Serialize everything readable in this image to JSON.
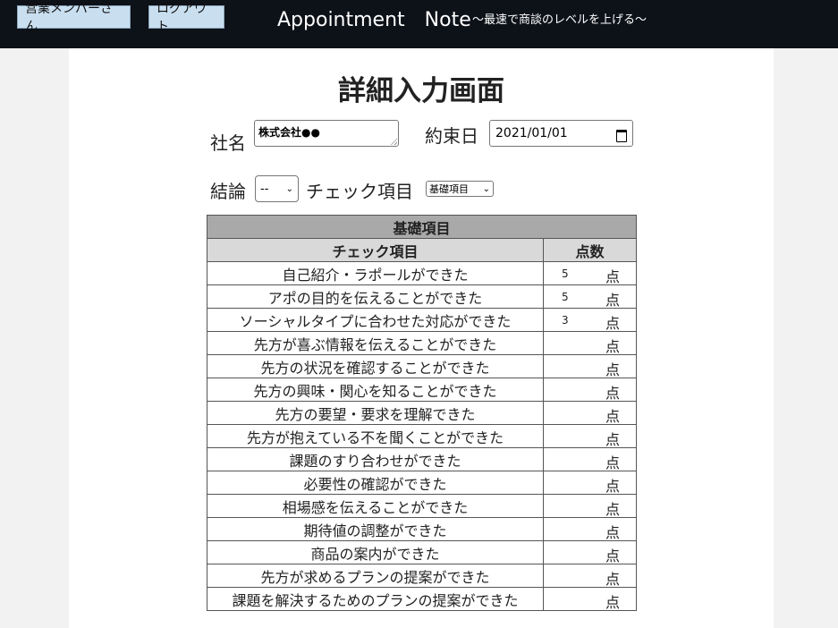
{
  "header": {
    "member_button": "営業メンバーさん",
    "logout_button": "ログアウト",
    "app_title": "Appointment　Note",
    "app_subtitle": "〜最速で商談のレベルを上げる〜"
  },
  "form": {
    "page_title": "詳細入力画面",
    "company_label": "社名",
    "company_value": "株式会社●●",
    "date_label": "約束日",
    "date_value": "2021/01/01",
    "conclusion_label": "結論",
    "conclusion_selected": "--",
    "check_label": "チェック項目",
    "check_selected": "基礎項目"
  },
  "table": {
    "section_title": "基礎項目",
    "col_item": "チェック項目",
    "col_score": "点数",
    "unit": "点",
    "rows": [
      {
        "item": "自己紹介・ラポールができた",
        "score": "5"
      },
      {
        "item": "アポの目的を伝えることができた",
        "score": "5"
      },
      {
        "item": "ソーシャルタイプに合わせた対応ができた",
        "score": "3"
      },
      {
        "item": "先方が喜ぶ情報を伝えることができた",
        "score": ""
      },
      {
        "item": "先方の状況を確認することができた",
        "score": ""
      },
      {
        "item": "先方の興味・関心を知ることができた",
        "score": ""
      },
      {
        "item": "先方の要望・要求を理解できた",
        "score": ""
      },
      {
        "item": "先方が抱えている不を聞くことができた",
        "score": ""
      },
      {
        "item": "課題のすり合わせができた",
        "score": ""
      },
      {
        "item": "必要性の確認ができた",
        "score": ""
      },
      {
        "item": "相場感を伝えることができた",
        "score": ""
      },
      {
        "item": "期待値の調整ができた",
        "score": ""
      },
      {
        "item": "商品の案内ができた",
        "score": ""
      },
      {
        "item": "先方が求めるプランの提案ができた",
        "score": ""
      },
      {
        "item": "課題を解決するためのプランの提案ができた",
        "score": ""
      }
    ]
  }
}
